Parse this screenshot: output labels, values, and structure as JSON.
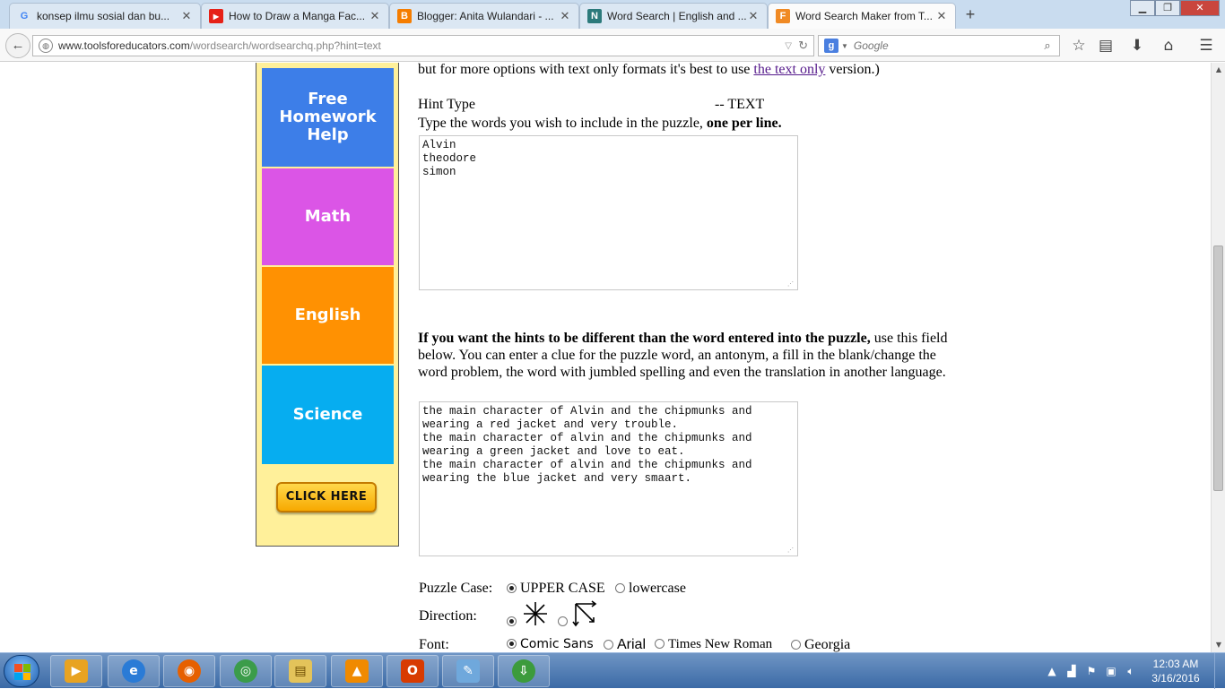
{
  "tabs": [
    {
      "title": "konsep ilmu sosial dan bu...",
      "icon": "google-icon",
      "icon_glyph": "G",
      "icon_color": "#4285f4",
      "active": false
    },
    {
      "title": "How to Draw a Manga Fac...",
      "icon": "youtube-icon",
      "icon_glyph": "▶",
      "icon_color": "#e62117",
      "active": false
    },
    {
      "title": "Blogger: Anita Wulandari - ...",
      "icon": "blogger-icon",
      "icon_glyph": "B",
      "icon_color": "#f57d00",
      "active": false
    },
    {
      "title": "Word Search | English and ...",
      "icon": "word-search-site-icon",
      "icon_glyph": "N",
      "icon_color": "#2c7a7b",
      "active": false
    },
    {
      "title": "Word Search Maker from T...",
      "icon": "tools-for-educators-icon",
      "icon_glyph": "F",
      "icon_color": "#f08a24",
      "active": true
    }
  ],
  "new_tab_label": "+",
  "window": {
    "minimize": "▁",
    "maximize": "❐",
    "close": "✕"
  },
  "nav": {
    "back": "←",
    "url_host": "www.toolsforeducators.com",
    "url_path": "/wordsearch/wordsearchq.php?hint=text",
    "search_engine": "g",
    "search_placeholder": "Google"
  },
  "sidebar": {
    "items": [
      {
        "label": "Free Homework Help",
        "color": "#3d7ee8"
      },
      {
        "label": "Math",
        "color": "#db55e6"
      },
      {
        "label": "English",
        "color": "#ff9102"
      },
      {
        "label": "Science",
        "color": "#06adf0"
      }
    ],
    "cta": "CLICK HERE"
  },
  "content": {
    "intro_line": "but for more options with text only formats it's best to use",
    "intro_link": "the text only",
    "intro_tail": "version.)",
    "hint_type_label": "Hint Type",
    "hint_type_value": "-- TEXT",
    "words_instruction": "Type the words you wish to include in the puzzle,",
    "words_instruction_bold": "one per line.",
    "words_value": "Alvin\ntheodore\nsimon",
    "hints_instruction_bold": "If you want the hints to be different than the word entered into the puzzle,",
    "hints_instruction": "use this field below. You can enter a clue for the puzzle word, an antonym, a fill in the blank/change the word problem, the word with jumbled spelling and even the translation in another language.",
    "hints_value": "the main character of Alvin and the chipmunks and\nwearing a red jacket and very trouble.\nthe main character of alvin and the chipmunks and\nwearing a green jacket and love to eat.\nthe main character of alvin and the chipmunks and\nwearing the blue jacket and very smaart.",
    "puzzle_case_label": "Puzzle Case:",
    "case_options": [
      "UPPER CASE",
      "lowercase"
    ],
    "direction_label": "Direction:",
    "font_label": "Font:",
    "font_options": [
      "Comic Sans",
      "Arial",
      "Times New Roman",
      "Georgia"
    ]
  },
  "taskbar": {
    "apps": [
      {
        "name": "media-player-icon",
        "color": "#e8a321",
        "glyph": "▶"
      },
      {
        "name": "internet-explorer-icon",
        "color": "#2a7bd6",
        "glyph": "e"
      },
      {
        "name": "firefox-icon",
        "color": "#e66000",
        "glyph": "◉"
      },
      {
        "name": "chrome-icon",
        "color": "#3b9c4a",
        "glyph": "◎"
      },
      {
        "name": "file-explorer-icon",
        "color": "#e3c35a",
        "glyph": "▤"
      },
      {
        "name": "vlc-icon",
        "color": "#f08a00",
        "glyph": "▲"
      },
      {
        "name": "office-icon",
        "color": "#d83b01",
        "glyph": "O"
      },
      {
        "name": "paint-icon",
        "color": "#6fa8dc",
        "glyph": "✎"
      },
      {
        "name": "internet-download-manager-icon",
        "color": "#3c9b3c",
        "glyph": "⇩"
      }
    ],
    "time": "12:03 AM",
    "date": "3/16/2016"
  }
}
